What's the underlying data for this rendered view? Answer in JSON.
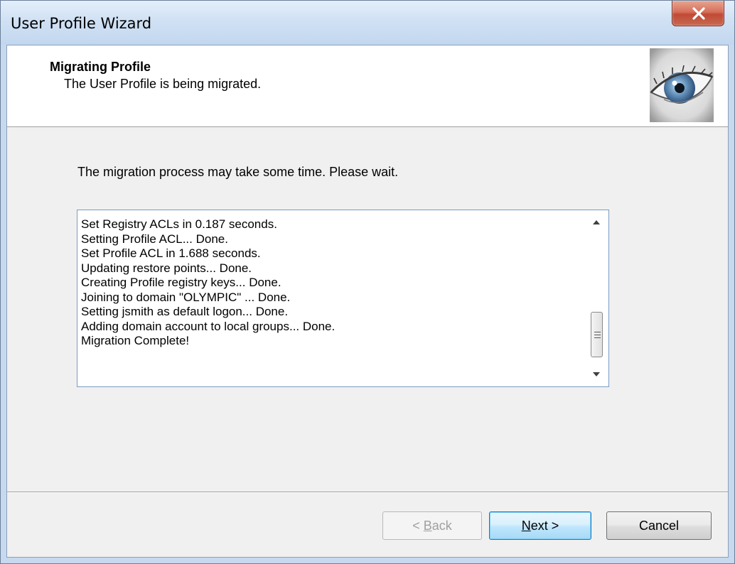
{
  "window": {
    "title": "User Profile Wizard"
  },
  "header": {
    "title": "Migrating Profile",
    "subtitle": "The User Profile is being migrated."
  },
  "main": {
    "intro_text": "The migration process may take some time. Please wait.",
    "log_lines": [
      "Set Registry ACLs in 0.187 seconds.",
      "Setting Profile ACL... Done.",
      "Set Profile ACL in 1.688 seconds.",
      "Updating restore points... Done.",
      "Creating Profile registry keys... Done.",
      "Joining to domain \"OLYMPIC\" ... Done.",
      "Setting jsmith as default logon... Done.",
      "Adding domain account to local groups... Done.",
      "Migration Complete!"
    ]
  },
  "buttons": {
    "back": {
      "label": "< Back",
      "prefix": "< ",
      "mnemonic": "B",
      "rest": "ack",
      "enabled": false
    },
    "next": {
      "label": "Next >",
      "mnemonic": "N",
      "rest": "ext >",
      "enabled": true
    },
    "cancel": {
      "label": "Cancel",
      "enabled": true
    }
  },
  "icons": {
    "close": "close-icon",
    "logo": "eye-logo-icon",
    "scroll_up": "scroll-up-arrow-icon",
    "scroll_down": "scroll-down-arrow-icon"
  },
  "colors": {
    "titlebar": "#c7d9ef",
    "close_button": "#c14a35",
    "default_button_border": "#2a73b8"
  }
}
